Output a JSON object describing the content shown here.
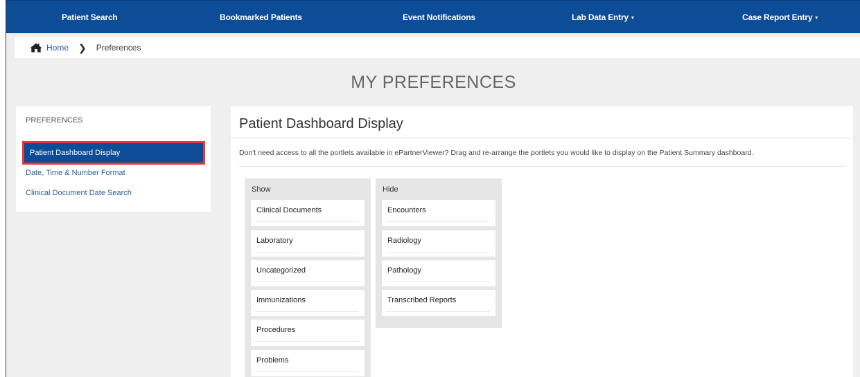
{
  "nav": {
    "items": [
      {
        "label": "Patient Search",
        "caret": ""
      },
      {
        "label": "Bookmarked Patients",
        "caret": ""
      },
      {
        "label": "Event Notifications",
        "caret": ""
      },
      {
        "label": "Lab Data Entry",
        "caret": "▾"
      },
      {
        "label": "Case Report Entry",
        "caret": "▾"
      }
    ]
  },
  "breadcrumb": {
    "home": "Home",
    "separator": "❯",
    "current": "Preferences"
  },
  "page": {
    "title": "MY PREFERENCES"
  },
  "sidebar": {
    "heading": "PREFERENCES",
    "items": [
      {
        "label": "Patient Dashboard Display"
      },
      {
        "label": "Date, Time & Number Format"
      },
      {
        "label": "Clinical Document Date Search"
      }
    ]
  },
  "main": {
    "title": "Patient Dashboard Display",
    "description": "Don't need access to all the portlets available in ePartnerViewer? Drag and re-arrange the portlets you would like to display on the Patient Summary dashboard.",
    "show": {
      "label": "Show",
      "items": [
        "Clinical Documents",
        "Laboratory",
        "Uncategorized",
        "Immunizations",
        "Procedures",
        "Problems"
      ]
    },
    "hide": {
      "label": "Hide",
      "items": [
        "Encounters",
        "Radiology",
        "Pathology",
        "Transcribed Reports"
      ]
    }
  },
  "colors": {
    "nav_bg": "#0d4c97",
    "highlight_border": "#e8383d",
    "link": "#2a5d9f"
  }
}
